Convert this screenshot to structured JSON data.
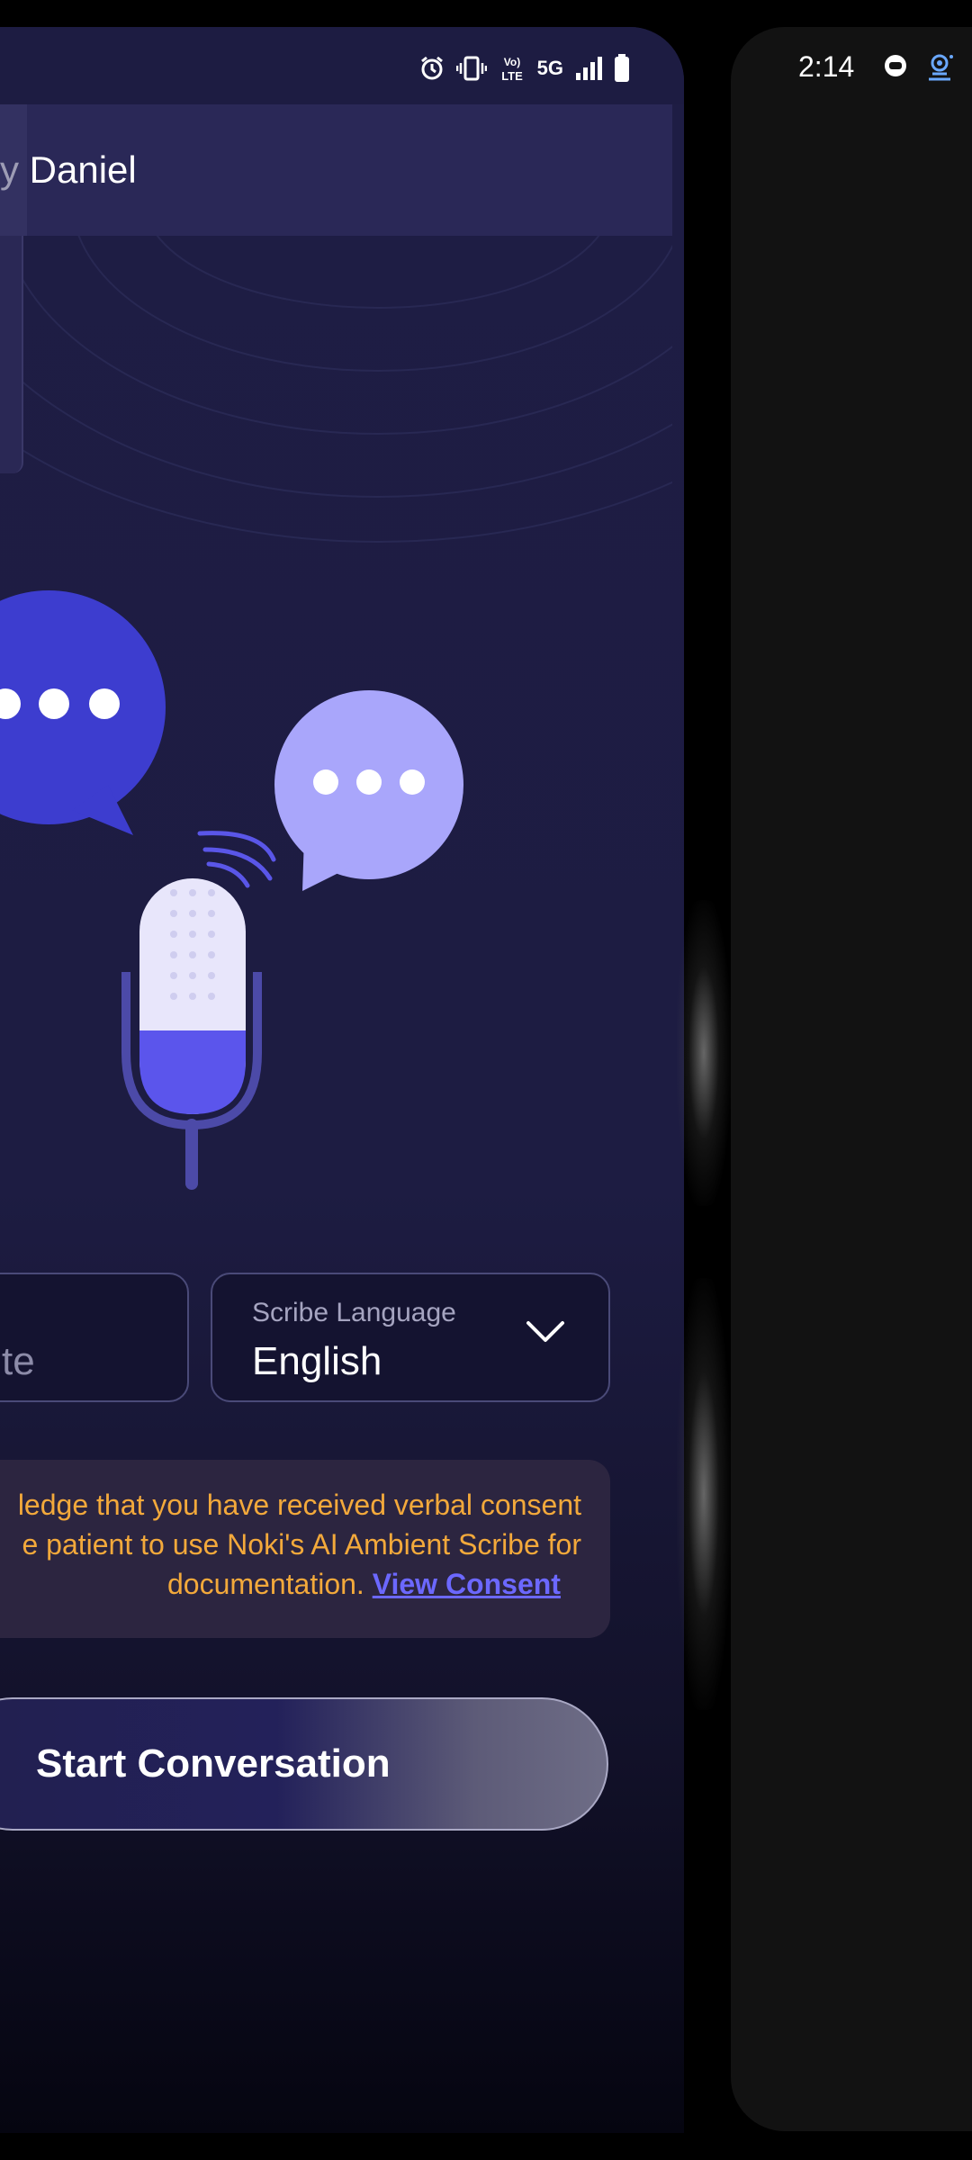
{
  "status_bar": {
    "network_label": "5G",
    "volte_label": "VoLTE",
    "icons": [
      "alarm-icon",
      "vibrate-icon",
      "volte-icon",
      "signal-icon",
      "battery-icon"
    ]
  },
  "header": {
    "title": "y Daniel"
  },
  "selectors": {
    "left_partial_value": "te",
    "language_label": "Scribe Language",
    "language_value": "English"
  },
  "consent": {
    "line1": "ledge that you have received verbal consent",
    "line2": "e patient to use Noki's AI Ambient Scribe for",
    "line3_prefix": "documentation. ",
    "link_text": "View Consent"
  },
  "start_button": {
    "label": "Start Conversation"
  },
  "right_panel": {
    "time": "2:14"
  },
  "colors": {
    "background": "#1d1c42",
    "header": "#2a2857",
    "consent_text": "#f3a93b",
    "link": "#6c68ff",
    "bubble_dark": "#3b3bd0",
    "bubble_light": "#a9a6fb"
  }
}
